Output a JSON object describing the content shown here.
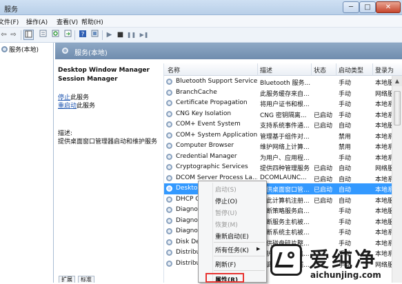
{
  "window": {
    "title": "服务",
    "minimize_glyph": "─",
    "maximize_glyph": "□",
    "close_glyph": "✕"
  },
  "menu": [
    "文件(F)",
    "操作(A)",
    "查看(V)",
    "帮助(H)"
  ],
  "toolbar": {
    "icons": [
      "back-arrow-icon",
      "forward-arrow-icon",
      "show-hide-tree-icon",
      "properties-icon",
      "refresh-icon",
      "export-icon",
      "help-icon",
      "console-icon",
      "start-service-icon",
      "stop-service-icon",
      "pause-service-icon",
      "restart-service-icon"
    ],
    "glyphs": {
      "back": "⇦",
      "forward": "⇨",
      "start": "▶",
      "stop": "■",
      "pause": "❚❚",
      "restart": "▶❚"
    }
  },
  "tree": {
    "root_label": "服务(本地)"
  },
  "content_header": {
    "label": "服务(本地)"
  },
  "description_panel": {
    "service_name_line1": "Desktop Window Manager",
    "service_name_line2": "Session Manager",
    "stop_link": "停止",
    "stop_suffix": "此服务",
    "restart_link": "重启动",
    "restart_suffix": "此服务",
    "desc_label": "描述:",
    "desc_text": "提供桌面窗口管理器启动和维护服务"
  },
  "columns": {
    "name": "名称",
    "description": "描述",
    "status": "状态",
    "startup": "启动类型",
    "logon": "登录为"
  },
  "rows": [
    {
      "name": "Bluetooth Support Service",
      "description": "Bluetooth 服务...",
      "status": "",
      "startup": "手动",
      "logon": "本地服"
    },
    {
      "name": "BranchCache",
      "description": "此服务缓存来自...",
      "status": "",
      "startup": "手动",
      "logon": "网络服"
    },
    {
      "name": "Certificate Propagation",
      "description": "将用户证书和根...",
      "status": "",
      "startup": "手动",
      "logon": "本地系"
    },
    {
      "name": "CNG Key Isolation",
      "description": "CNG 密钥隔离...",
      "status": "已启动",
      "startup": "手动",
      "logon": "本地系"
    },
    {
      "name": "COM+ Event System",
      "description": "支持系统事件通...",
      "status": "已启动",
      "startup": "自动",
      "logon": "本地服"
    },
    {
      "name": "COM+ System Application",
      "description": "管理基于组件对...",
      "status": "",
      "startup": "禁用",
      "logon": "本地系"
    },
    {
      "name": "Computer Browser",
      "description": "维护网络上计算...",
      "status": "",
      "startup": "禁用",
      "logon": "本地系"
    },
    {
      "name": "Credential Manager",
      "description": "为用户、应用程...",
      "status": "",
      "startup": "手动",
      "logon": "本地系"
    },
    {
      "name": "Cryptographic Services",
      "description": "提供四种管理服务",
      "status": "已启动",
      "startup": "自动",
      "logon": "网络服"
    },
    {
      "name": "DCOM Server Process La...",
      "description": "DCOMLAUNC...",
      "status": "已启动",
      "startup": "自动",
      "logon": "本地系"
    },
    {
      "name": "Desktop Window Manager...",
      "description": "提供桌面窗口管...",
      "status": "已启动",
      "startup": "自动",
      "logon": "本地系",
      "selected": true
    },
    {
      "name": "DHCP Client",
      "description": "为此计算机注册...",
      "status": "已启动",
      "startup": "自动",
      "logon": "本地服"
    },
    {
      "name": "Diagnostic Policy Service",
      "description": "诊断策略服务启...",
      "status": "",
      "startup": "手动",
      "logon": "本地服"
    },
    {
      "name": "Diagnostic Service Host",
      "description": "诊断服务主机被...",
      "status": "",
      "startup": "手动",
      "logon": "本地服"
    },
    {
      "name": "Diagnostic System Host",
      "description": "诊断系统主机被...",
      "status": "",
      "startup": "手动",
      "logon": "本地系"
    },
    {
      "name": "Disk Defragmenter",
      "description": "提供磁盘碎片整...",
      "status": "",
      "startup": "手动",
      "logon": "本地系"
    },
    {
      "name": "Distributed Link Tracking",
      "description": "维护某个计算机...",
      "status": "",
      "startup": "手动",
      "logon": "本地系"
    },
    {
      "name": "Distributed Transaction",
      "description": "协调跨多个数据...",
      "status": "",
      "startup": "手动",
      "logon": "网络服"
    }
  ],
  "scrollbar": {
    "up_glyph": "▲"
  },
  "context_menu": {
    "items": [
      {
        "label": "启动(S)",
        "disabled": true
      },
      {
        "label": "停止(O)",
        "disabled": false
      },
      {
        "label": "暂停(U)",
        "disabled": true
      },
      {
        "label": "恢复(M)",
        "disabled": true
      },
      {
        "label": "重新启动(E)",
        "disabled": false
      },
      {
        "label": "所有任务(K)",
        "disabled": false,
        "submenu_glyph": "▶"
      },
      {
        "label": "刷新(F)",
        "disabled": false
      },
      {
        "label": "属性(R)",
        "disabled": false,
        "bold": true
      }
    ]
  },
  "bottom_tabs": [
    "扩展",
    "标准"
  ],
  "watermark": {
    "text": "爱纯净",
    "url": "aichunjing.com"
  }
}
